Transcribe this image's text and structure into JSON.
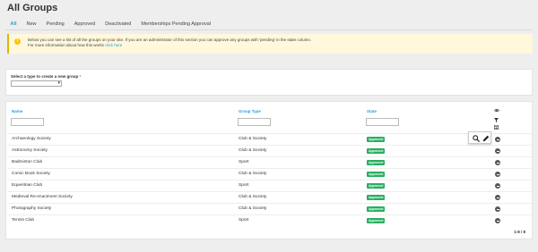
{
  "page_title": "All Groups",
  "tabs": [
    {
      "label": "All"
    },
    {
      "label": "New"
    },
    {
      "label": "Pending"
    },
    {
      "label": "Approved"
    },
    {
      "label": "Deactivated"
    },
    {
      "label": "Memberships Pending Approval"
    }
  ],
  "alert": {
    "icon": "exclamation-icon",
    "line1": "Below you can see a list of all the groups on your site. If you are an administrator of this section you can approve any groups with 'pending' in the state column.",
    "line2_prefix": "For more information about how this works ",
    "line2_link": "click here"
  },
  "create": {
    "label": "Select a type to create a new group",
    "required_mark": "*",
    "select_value": ""
  },
  "table": {
    "columns": [
      "Name",
      "Group Type",
      "State"
    ],
    "rows": [
      {
        "name": "Archaeology Society",
        "type": "Club & Society",
        "state": "Approved"
      },
      {
        "name": "Astronomy Society",
        "type": "Club & Society",
        "state": "Approved"
      },
      {
        "name": "Badminton Club",
        "type": "Sport",
        "state": "Approved"
      },
      {
        "name": "Comic Book Society",
        "type": "Club & Society",
        "state": "Approved"
      },
      {
        "name": "Equestrian Club",
        "type": "Sport",
        "state": "Approved"
      },
      {
        "name": "Medieval Re-enactment Society",
        "type": "Club & Society",
        "state": "Approved"
      },
      {
        "name": "Photography Society",
        "type": "Club & Society",
        "state": "Approved"
      },
      {
        "name": "Tennis Club",
        "type": "Sport",
        "state": "Approved"
      }
    ],
    "pager": "1-8 / 8"
  },
  "colors": {
    "accent": "#2a9fd6",
    "approved": "#27ae60",
    "alert_bg": "#fff8dc"
  }
}
